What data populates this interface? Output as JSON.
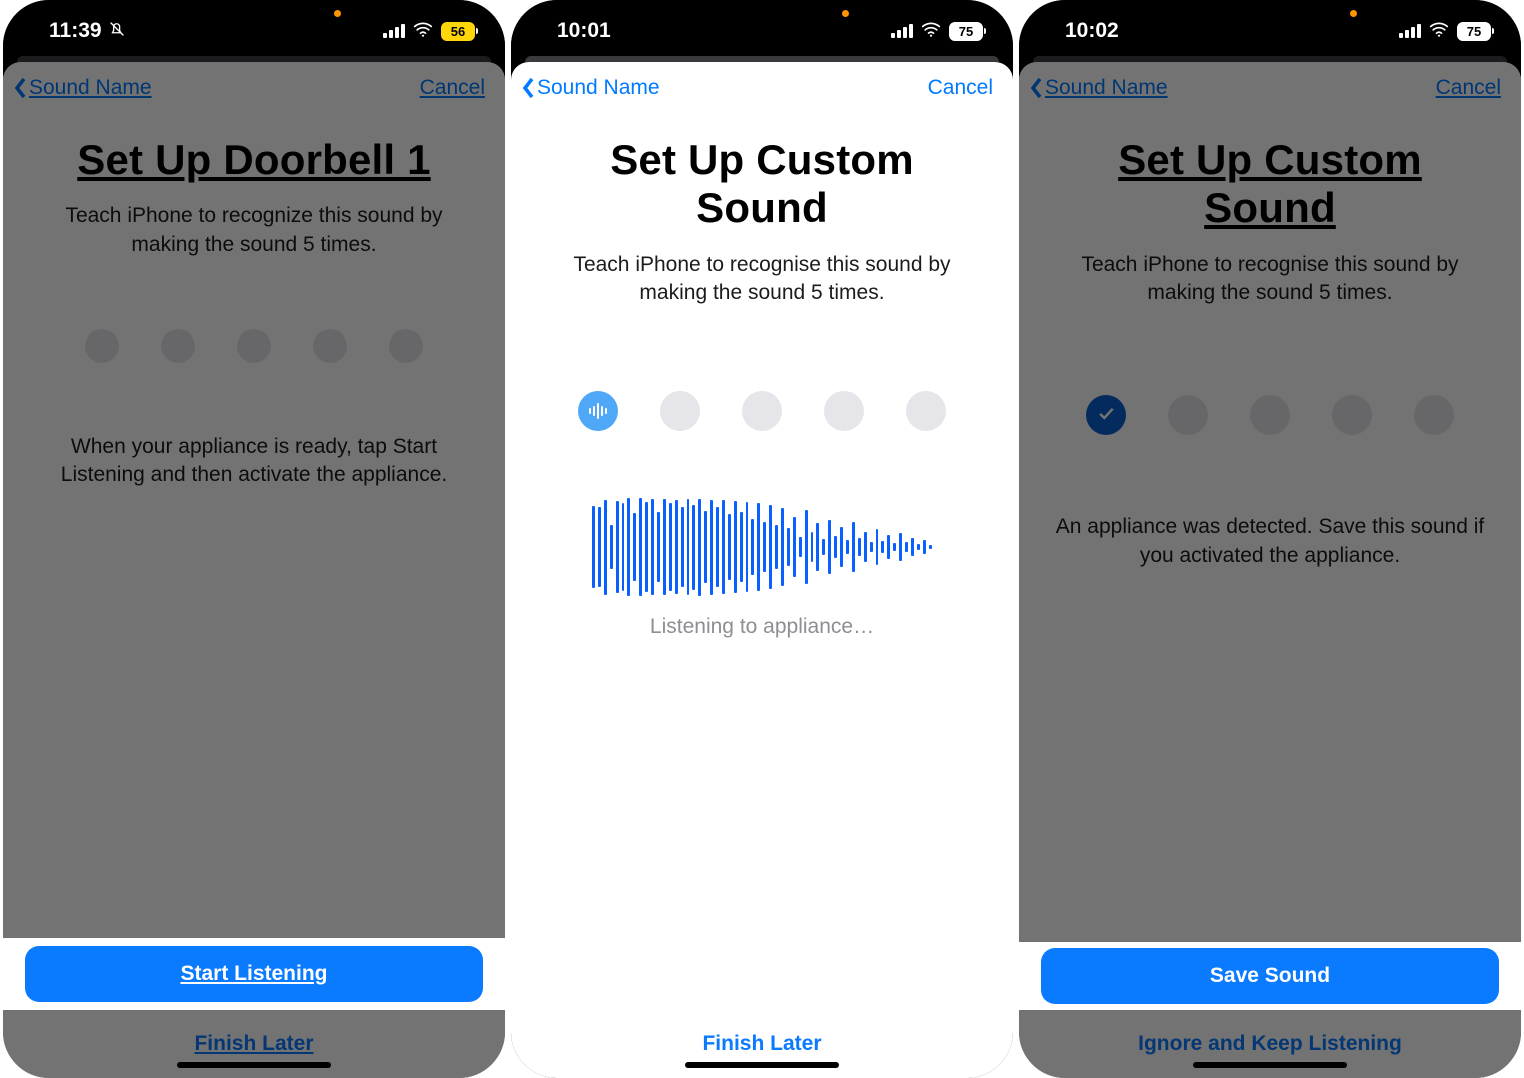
{
  "screens": [
    {
      "time": "11:39",
      "battery": "56",
      "dnd": true,
      "back_label": "Sound Name",
      "cancel_label": "Cancel",
      "title": "Set Up Doorbell 1",
      "subtitle": "Teach iPhone to recognize this sound by making the sound 5 times.",
      "hint": "When your appliance is ready, tap Start Listening and then activate the appliance.",
      "primary": "Start Listening",
      "secondary": "Finish Later"
    },
    {
      "time": "10:01",
      "battery": "75",
      "dnd": false,
      "back_label": "Sound Name",
      "cancel_label": "Cancel",
      "title": "Set Up Custom Sound",
      "subtitle": "Teach iPhone to recognise this sound by making the sound 5 times.",
      "listening": "Listening to appliance…",
      "secondary": "Finish Later"
    },
    {
      "time": "10:02",
      "battery": "75",
      "dnd": false,
      "back_label": "Sound Name",
      "cancel_label": "Cancel",
      "title": "Set Up Custom Sound",
      "subtitle": "Teach iPhone to recognise this sound by making the sound 5 times.",
      "hint": "An appliance was detected. Save this sound if you activated the appliance.",
      "primary": "Save Sound",
      "secondary": "Ignore and Keep Listening"
    }
  ],
  "icons": {
    "wifi": "wifi-icon",
    "cellular": "cellular-icon",
    "bell_slash": "bell-slash-icon",
    "chevron_left": "chevron-left-icon",
    "waveform_dot": "waveform-icon",
    "checkmark": "checkmark-icon"
  },
  "colors": {
    "accent": "#007aff",
    "primary_button": "#0a7aff",
    "battery_low_power": "#ffd60a",
    "dot_empty": "#e5e5ea",
    "dot_active": "#4ea8f7",
    "dot_done": "#0a60d1"
  }
}
